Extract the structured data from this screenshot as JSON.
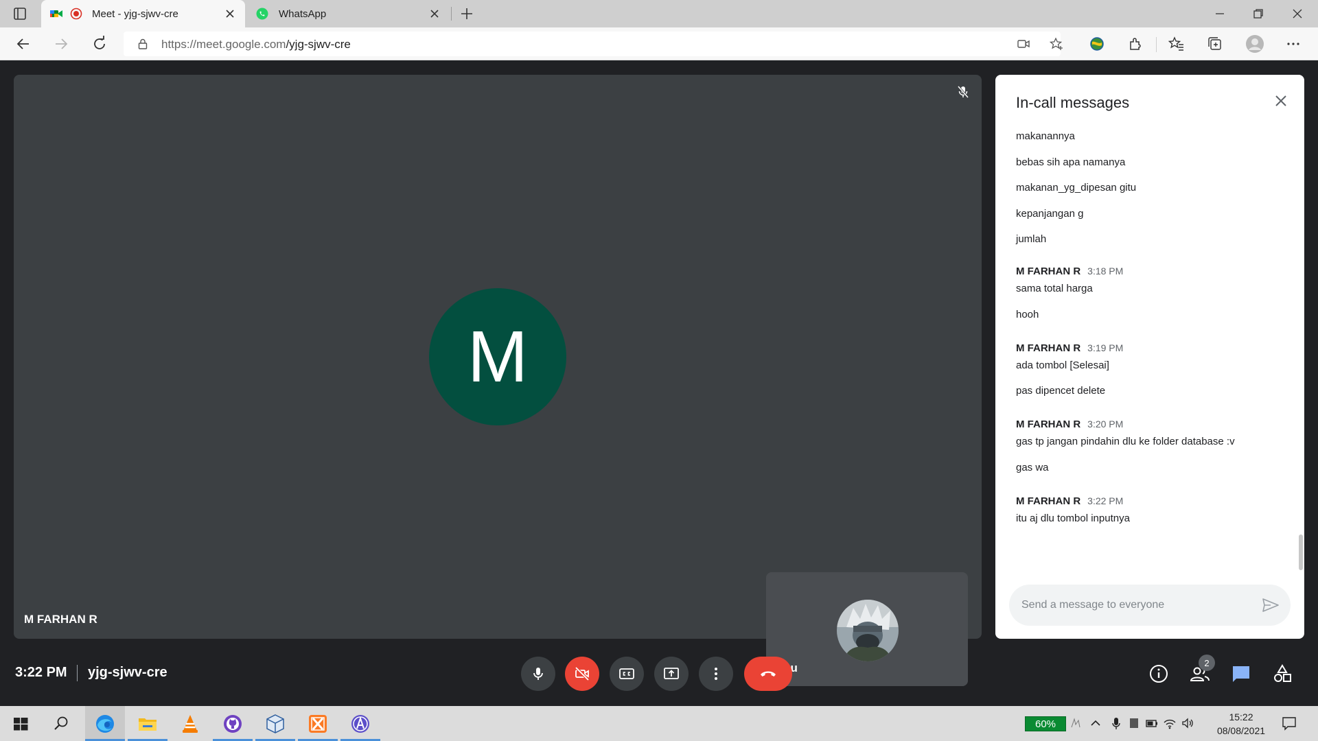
{
  "browser": {
    "tabs": [
      {
        "title": "Meet - yjg-sjwv-cre",
        "active": true
      },
      {
        "title": "WhatsApp",
        "active": false
      }
    ],
    "url_domain": "https://meet.google.com",
    "url_path": "/yjg-sjwv-cre"
  },
  "meet": {
    "main_tile": {
      "avatar_letter": "M",
      "participant_name": "M FARHAN R",
      "avatar_color": "#034f3f"
    },
    "self_tile": {
      "label": "You"
    },
    "bottom_bar": {
      "time": "3:22 PM",
      "meeting_code": "yjg-sjwv-cre",
      "people_count": "2"
    },
    "chat": {
      "title": "In-call messages",
      "leading_messages": [
        "makanannya",
        "bebas sih apa namanya",
        "makanan_yg_dipesan gitu",
        "kepanjangan g",
        "jumlah"
      ],
      "groups": [
        {
          "sender": "M FARHAN R",
          "time": "3:18 PM",
          "messages": [
            "sama total harga",
            "hooh"
          ]
        },
        {
          "sender": "M FARHAN R",
          "time": "3:19 PM",
          "messages": [
            "ada tombol [Selesai]",
            "pas dipencet delete"
          ]
        },
        {
          "sender": "M FARHAN R",
          "time": "3:20 PM",
          "messages": [
            "gas tp jangan pindahin dlu ke folder database :v",
            "gas wa"
          ]
        },
        {
          "sender": "M FARHAN R",
          "time": "3:22 PM",
          "messages": [
            "itu aj dlu tombol inputnya"
          ]
        }
      ],
      "input_placeholder": "Send a message to everyone"
    }
  },
  "taskbar": {
    "battery": "60%",
    "time": "15:22",
    "date": "08/08/2021"
  },
  "colors": {
    "meet_background": "#202124",
    "tile_background": "#3c4043",
    "hangup_red": "#ea4335",
    "chat_accent": "#1a73e8"
  }
}
